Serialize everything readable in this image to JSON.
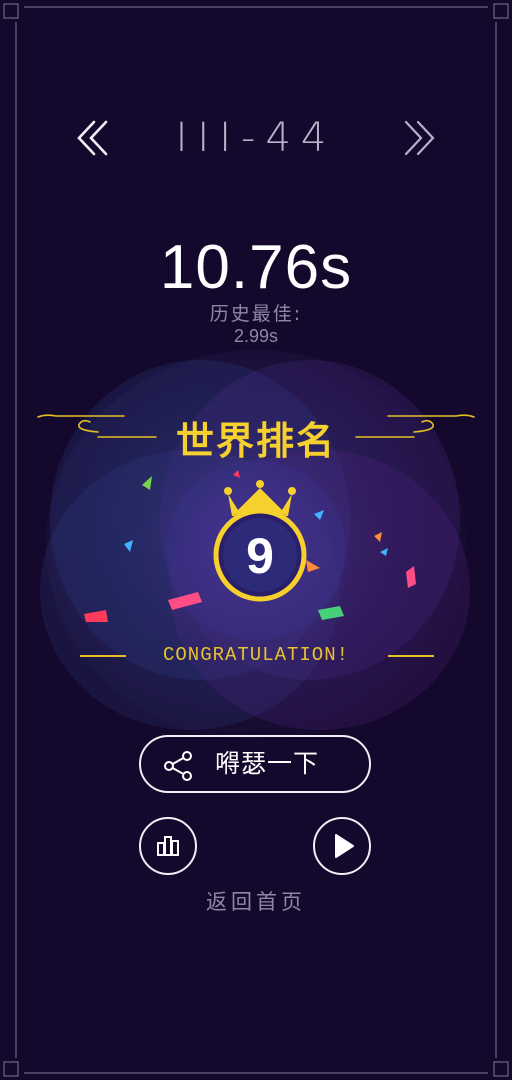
{
  "header": {
    "level": "III-44"
  },
  "result": {
    "time": "10.76s",
    "best_label": "历史最佳:",
    "best_time": "2.99s"
  },
  "ranking": {
    "title": "世界排名",
    "rank": "9",
    "congrats": "CONGRATULATION!"
  },
  "actions": {
    "share_label": "嘚瑟一下",
    "home_label": "返回首页"
  },
  "colors": {
    "background": "#14092c",
    "gold": "#f6d12e",
    "muted_text": "#8f87a3",
    "outline": "#f2eff7"
  },
  "icons": {
    "prev": "double-chevron-left-icon",
    "next": "double-chevron-right-icon",
    "share": "share-icon",
    "leaderboard": "bar-chart-icon",
    "play": "play-icon",
    "crown": "crown-icon"
  }
}
